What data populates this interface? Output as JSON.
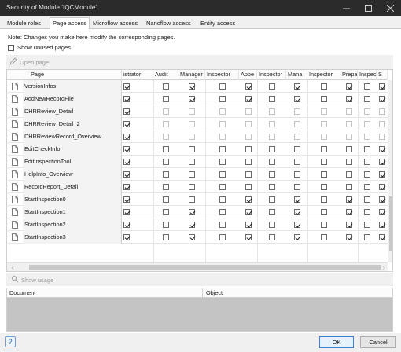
{
  "window": {
    "title": "Security of Module 'IQCModule'",
    "buttons": [
      "minimize-icon",
      "maximize-icon",
      "close-icon"
    ]
  },
  "tabs": [
    {
      "label": "Module roles",
      "active": false
    },
    {
      "label": "Page access",
      "active": true
    },
    {
      "label": "Microflow access",
      "active": false
    },
    {
      "label": "Nanoflow access",
      "active": false
    },
    {
      "label": "Entity access",
      "active": false
    }
  ],
  "note": "Note: Changes you make here modify the corresponding pages.",
  "show_unused": {
    "label": "Show unused pages",
    "checked": false
  },
  "toolbar": {
    "open_page": "Open page",
    "icon": "pencil-icon"
  },
  "grid": {
    "page_header": "Page",
    "columns": [
      "istrator",
      "Audit",
      "Manager",
      "Inspector",
      "Appe",
      "Inspector",
      "Mana",
      "Inspector",
      "Prepa",
      "Inspector",
      "S"
    ],
    "rows": [
      {
        "page": "VersionInfos",
        "access": [
          true,
          false,
          true,
          false,
          true,
          false,
          true,
          false,
          true,
          false,
          true
        ]
      },
      {
        "page": "AddNewRecordFile",
        "access": [
          true,
          false,
          true,
          false,
          true,
          false,
          true,
          false,
          true,
          false,
          true
        ]
      },
      {
        "page": "DHRReview_Detail",
        "access": [
          true,
          false,
          false,
          false,
          false,
          false,
          false,
          false,
          false,
          false,
          false
        ]
      },
      {
        "page": "DHRReview_Detail_2",
        "access": [
          true,
          false,
          false,
          false,
          false,
          false,
          false,
          false,
          false,
          false,
          false
        ]
      },
      {
        "page": "DHRReviewRecord_Overview",
        "access": [
          true,
          false,
          false,
          false,
          false,
          false,
          false,
          false,
          false,
          false,
          false
        ]
      },
      {
        "page": "EditCheckInfo",
        "access": [
          true,
          false,
          false,
          false,
          false,
          false,
          false,
          false,
          false,
          false,
          true
        ]
      },
      {
        "page": "EditInspectionTool",
        "access": [
          true,
          false,
          false,
          false,
          false,
          false,
          false,
          false,
          false,
          false,
          true
        ]
      },
      {
        "page": "HelpInfo_Overview",
        "access": [
          true,
          false,
          false,
          false,
          false,
          false,
          false,
          false,
          false,
          false,
          true
        ]
      },
      {
        "page": "RecordReport_Detail",
        "access": [
          true,
          false,
          false,
          false,
          false,
          false,
          false,
          false,
          false,
          false,
          true
        ]
      },
      {
        "page": "StartInspection0",
        "access": [
          true,
          false,
          false,
          false,
          true,
          false,
          true,
          false,
          true,
          false,
          true
        ]
      },
      {
        "page": "StartInspection1",
        "access": [
          true,
          false,
          true,
          false,
          true,
          false,
          true,
          false,
          true,
          false,
          true
        ]
      },
      {
        "page": "StartInspection2",
        "access": [
          true,
          false,
          true,
          false,
          true,
          false,
          true,
          false,
          true,
          false,
          true
        ]
      },
      {
        "page": "StartInspection3",
        "access": [
          true,
          false,
          true,
          false,
          true,
          false,
          true,
          false,
          true,
          false,
          true
        ]
      }
    ]
  },
  "usage": {
    "label": "Show usage",
    "icon": "usage-icon",
    "col_document": "Document",
    "col_object": "Object"
  },
  "footer": {
    "help": "?",
    "ok": "OK",
    "cancel": "Cancel"
  }
}
